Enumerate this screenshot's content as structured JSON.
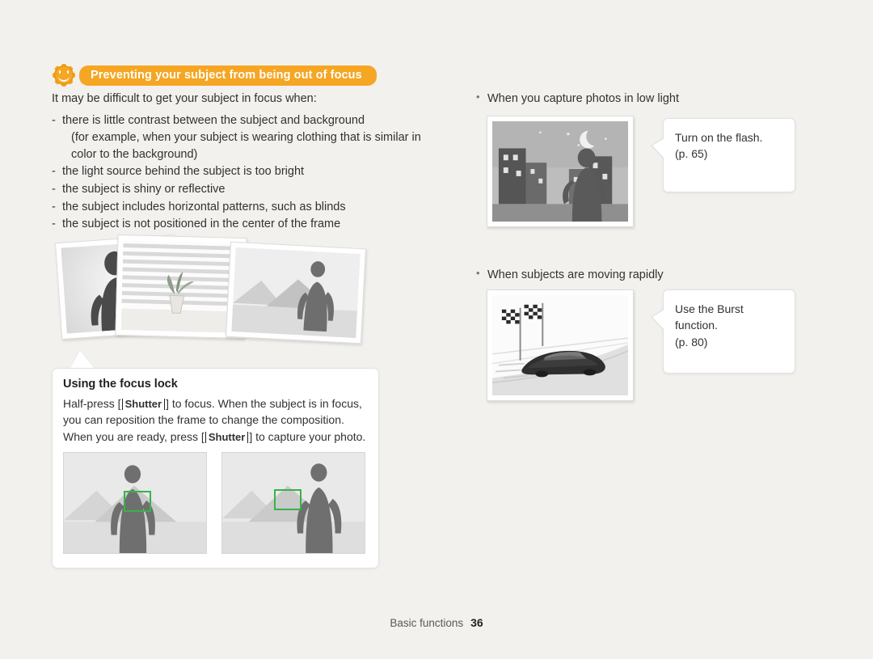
{
  "header": {
    "icon": "sun-smiley-icon",
    "title": "Preventing your subject from being out of focus"
  },
  "left": {
    "intro": "It may be difficult to get your subject in focus when:",
    "bullets": [
      "there is little contrast between the subject and background",
      "(for example, when your subject is wearing clothing that is similar in color to the background)",
      "the light source behind the subject is too bright",
      "the subject is shiny or reflective",
      "the subject includes horizontal patterns, such as blinds",
      "the subject is not positioned in the center of the frame"
    ],
    "focus_lock": {
      "title": "Using the focus lock",
      "text_part1": "Half-press [",
      "key1": "Shutter",
      "text_part2": "] to focus. When the subject is in focus, you can reposition the frame to change the composition. When you are ready, press [",
      "key2": "Shutter",
      "text_part3": "] to capture your photo."
    }
  },
  "right": {
    "item1": {
      "caption": "When you capture photos in low light",
      "callout_line1": "Turn on the flash.",
      "callout_line2": "(p. 65)"
    },
    "item2": {
      "caption": "When subjects are moving rapidly",
      "callout_line1": "Use the Burst function.",
      "callout_line2": "(p. 80)"
    }
  },
  "footer": {
    "section": "Basic functions",
    "page": "36"
  },
  "colors": {
    "accent": "#f5a623",
    "page_bg": "#f2f1ed",
    "text": "#333133",
    "af_green": "#37b34a"
  }
}
